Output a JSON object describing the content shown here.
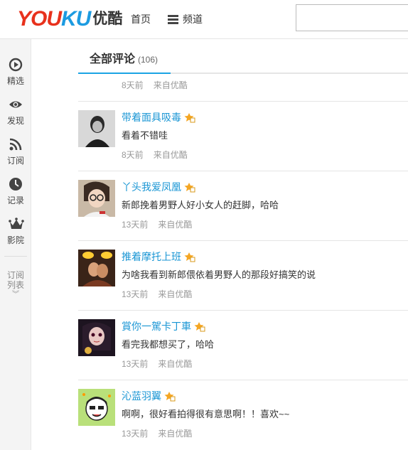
{
  "header": {
    "logo_en_you": "YOU",
    "logo_en_ku": "KU",
    "logo_cn": "优酷",
    "nav_home": "首页",
    "nav_channel": "频道",
    "search_placeholder": ""
  },
  "sidebar": {
    "items": [
      {
        "label": "精选",
        "icon": "play-circle-icon"
      },
      {
        "label": "发现",
        "icon": "eye-icon"
      },
      {
        "label": "订阅",
        "icon": "rss-icon"
      },
      {
        "label": "记录",
        "icon": "clock-icon"
      },
      {
        "label": "影院",
        "icon": "crown-icon"
      }
    ],
    "sub_line1": "订阅",
    "sub_line2": "列表",
    "sub_chevron": "︾"
  },
  "tabs": {
    "active_label": "全部评论",
    "count": "(106)"
  },
  "first_meta": {
    "time": "8天前",
    "from": "来自优酷"
  },
  "comments": [
    {
      "user": "带着面具吸毒",
      "text": "看着不错哇",
      "time": "8天前",
      "from": "来自优酷"
    },
    {
      "user": "丫头我爱凤凰",
      "text": "新郎挽着男野人好小女人的赶脚，哈哈",
      "time": "13天前",
      "from": "来自优酷"
    },
    {
      "user": "推着摩托上班",
      "text": "为啥我看到新郎偎依着男野人的那段好搞笑的说",
      "time": "13天前",
      "from": "来自优酷"
    },
    {
      "user": "賞你一駕卡丁車",
      "text": "看完我都想买了，哈哈",
      "time": "13天前",
      "from": "来自优酷"
    },
    {
      "user": "沁蓝羽翼",
      "text": "啊啊，很好看拍得很有意思啊！！喜欢~~",
      "time": "13天前",
      "from": "来自优酷"
    }
  ],
  "colors": {
    "brand_red": "#e8311c",
    "brand_blue": "#1c9be1",
    "username": "#1a96d4",
    "tab_underline": "#1ba4e4",
    "vip_badge": "#f5a623"
  }
}
